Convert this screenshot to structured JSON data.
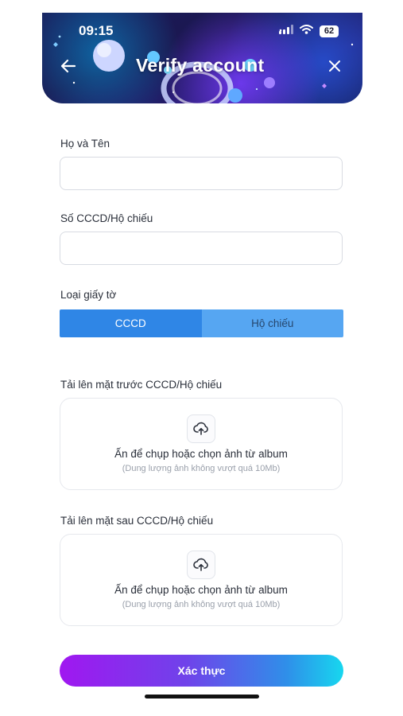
{
  "status_bar": {
    "time": "09:15",
    "battery": "62"
  },
  "header": {
    "title": "Verify account",
    "back_icon": "arrow-left-icon",
    "close_icon": "close-icon"
  },
  "form": {
    "full_name": {
      "label": "Họ và Tên",
      "value": "",
      "placeholder": ""
    },
    "id_number": {
      "label": "Số CCCD/Hộ chiếu",
      "value": "",
      "placeholder": ""
    },
    "doc_type": {
      "label": "Loại giấy tờ",
      "options": [
        "CCCD",
        "Hộ chiếu"
      ],
      "selected": "CCCD"
    },
    "front_upload": {
      "label": "Tải lên mặt trước CCCD/Hộ chiếu",
      "prompt": "Ấn để chụp hoặc chọn ảnh từ album",
      "hint": "(Dung lượng ảnh không vượt quá 10Mb)",
      "icon": "cloud-upload-icon"
    },
    "back_upload": {
      "label": "Tải lên mặt sau CCCD/Hộ chiếu",
      "prompt": "Ấn để chụp hoặc chọn ảnh từ album",
      "hint": "(Dung lượng ảnh không vượt quá 10Mb)",
      "icon": "cloud-upload-icon"
    }
  },
  "submit_label": "Xác thực",
  "colors": {
    "segment_active": "#2f86e6",
    "segment_inactive": "#56a6f2",
    "button_gradient_start": "#a017f0",
    "button_gradient_end": "#17d7ef",
    "banner_bg": "#1b1750"
  }
}
